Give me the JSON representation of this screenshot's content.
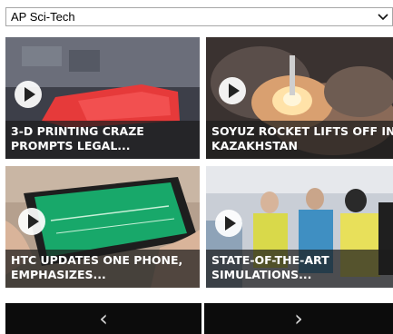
{
  "feed_select": {
    "selected": "AP Sci-Tech",
    "arrow_icon": "chevron-down-icon"
  },
  "videos": [
    {
      "title": "3-D PRINTING CRAZE PROMPTS LEGAL...",
      "icon": "play-icon"
    },
    {
      "title": "SOYUZ ROCKET LIFTS OFF IN KAZAKHSTAN",
      "icon": "play-icon"
    },
    {
      "title": "HTC UPDATES ONE PHONE, EMPHASIZES...",
      "icon": "play-icon"
    },
    {
      "title": "STATE-OF-THE-ART SIMULATIONS...",
      "icon": "play-icon"
    }
  ],
  "pager": {
    "prev_glyph": "‹",
    "next_glyph": "›"
  },
  "colors": {
    "caption_bg": "#1c1c1c",
    "pager_bg": "#0c0c0c",
    "select_border": "#a6a6a6"
  }
}
